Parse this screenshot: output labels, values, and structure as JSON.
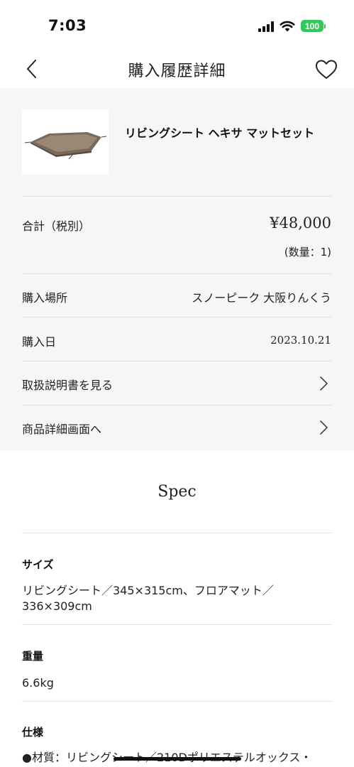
{
  "status_bar": {
    "time": "7:03",
    "battery": "100",
    "icons": [
      "signal-icon",
      "wifi-icon",
      "battery-icon"
    ],
    "battery_color": "#34c759"
  },
  "nav": {
    "title": "購入履歴詳細",
    "back_icon": "chevron-left-icon",
    "favorite_icon": "heart-outline-icon"
  },
  "product": {
    "name": "リビングシート ヘキサ マットセット"
  },
  "summary": {
    "total_label": "合計（税別）",
    "total_value": "¥48,000",
    "quantity": "(数量：1)",
    "store_label": "購入場所",
    "store_value": "スノーピーク 大阪りんくう",
    "date_label": "購入日",
    "date_value": "2023.10.21",
    "manual_link": "取扱説明書を見る",
    "detail_link": "商品詳細画面へ"
  },
  "spec": {
    "title": "Spec",
    "items": [
      {
        "heading": "サイズ",
        "value": "リビングシート／345×315cm、フロアマット／336×309cm"
      },
      {
        "heading": "重量",
        "value": "6.6kg"
      },
      {
        "heading": "仕様",
        "value": "●材質：リビングシート／210Dポリエステルオックス・"
      }
    ]
  },
  "colors": {
    "summary_background": "#f6f6f6",
    "divider": "#e2e2e2"
  }
}
